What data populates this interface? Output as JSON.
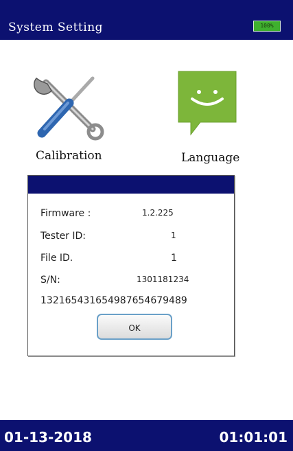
{
  "header": {
    "title": "System Setting",
    "battery": "100%"
  },
  "tiles": [
    {
      "label": "Calibration",
      "icon": "wrench-screwdriver-icon"
    },
    {
      "label": "Language",
      "icon": "smiley-speech-bubble-icon"
    }
  ],
  "dialog": {
    "rows": [
      {
        "label": "Firmware :",
        "value": "1.2.225"
      },
      {
        "label": "Tester ID:",
        "value": "1"
      },
      {
        "label": "File ID.",
        "value": "1"
      },
      {
        "label": "S/N:",
        "value": "1301181234"
      }
    ],
    "long_code": "132165431654987654679489",
    "ok_label": "OK"
  },
  "footer": {
    "date": "01-13-2018",
    "time": "01:01:01"
  },
  "colors": {
    "bar": "#0c1170",
    "battery": "#3fb02e",
    "language_icon": "#7db63a"
  }
}
